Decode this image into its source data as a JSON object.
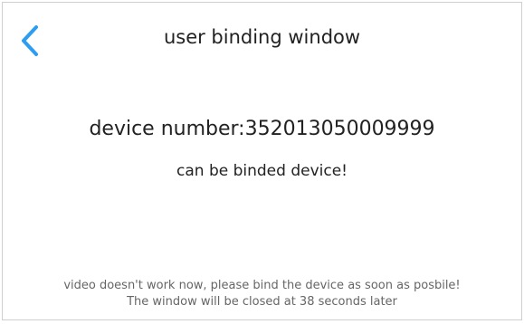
{
  "header": {
    "title": "user binding window",
    "back_icon": "chevron-left-icon",
    "back_color": "#2c9df0"
  },
  "main": {
    "device_label": "device number:",
    "device_number": "352013050009999",
    "status": "can be binded device!"
  },
  "footer": {
    "line1": "video doesn't work now, please bind the device as soon as posbile!",
    "line2_prefix": "The window will be closed at ",
    "countdown": "38",
    "line2_suffix": " seconds later"
  }
}
